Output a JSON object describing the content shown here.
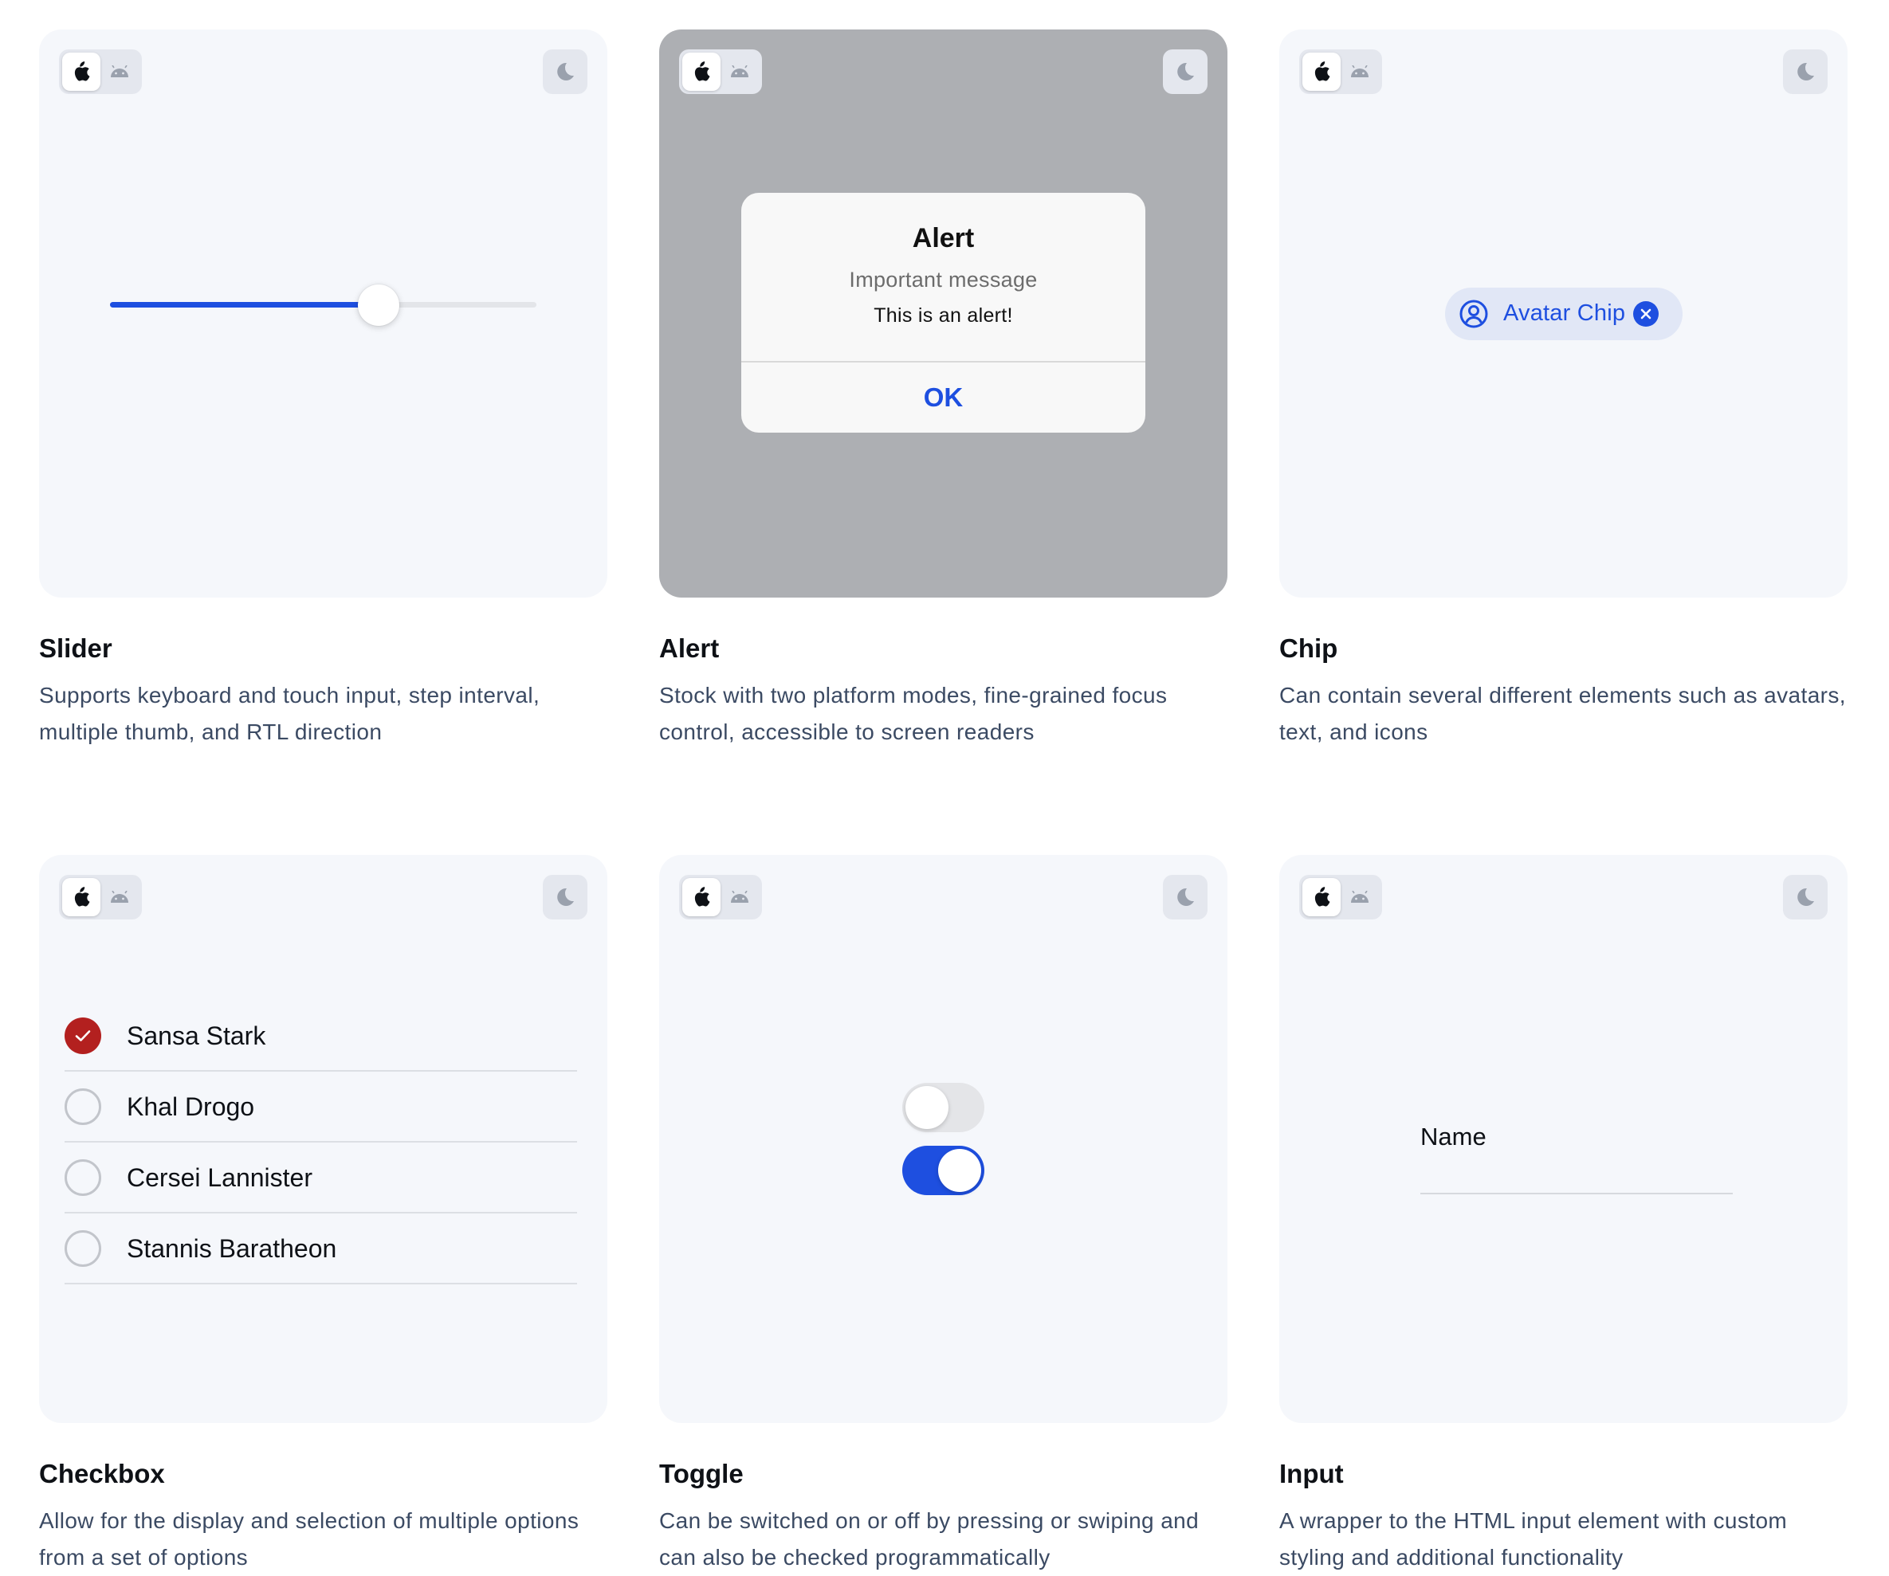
{
  "colors": {
    "accent": "#1e4fe0",
    "card_bg": "#f5f7fb",
    "checked": "#b3201f",
    "description": "#3b4a63"
  },
  "controls": {
    "ios_icon": "apple-icon",
    "android_icon": "android-icon",
    "dark_mode_icon": "moon-icon"
  },
  "cards": [
    {
      "title": "Slider",
      "description": "Supports keyboard and touch input, step interval, multiple thumb, and RTL direction",
      "slider": {
        "value_fraction": 0.63
      }
    },
    {
      "title": "Alert",
      "description": "Stock with two platform modes, fine-grained focus control, accessible to screen readers",
      "alert": {
        "header": "Alert",
        "sub_header": "Important message",
        "message": "This is an alert!",
        "button": "OK"
      }
    },
    {
      "title": "Chip",
      "description": "Can contain several different elements such as avatars, text, and icons",
      "chip": {
        "label": "Avatar Chip"
      }
    },
    {
      "title": "Checkbox",
      "description": "Allow for the display and selection of multiple options from a set of options",
      "options": [
        {
          "label": "Sansa Stark",
          "checked": true
        },
        {
          "label": "Khal Drogo",
          "checked": false
        },
        {
          "label": "Cersei Lannister",
          "checked": false
        },
        {
          "label": "Stannis Baratheon",
          "checked": false
        }
      ]
    },
    {
      "title": "Toggle",
      "description": "Can be switched on or off by pressing or swiping and can also be checked programmatically",
      "toggles": [
        {
          "on": false
        },
        {
          "on": true
        }
      ]
    },
    {
      "title": "Input",
      "description": "A wrapper to the HTML input element with custom styling and additional functionality",
      "input": {
        "label": "Name",
        "value": ""
      }
    }
  ]
}
